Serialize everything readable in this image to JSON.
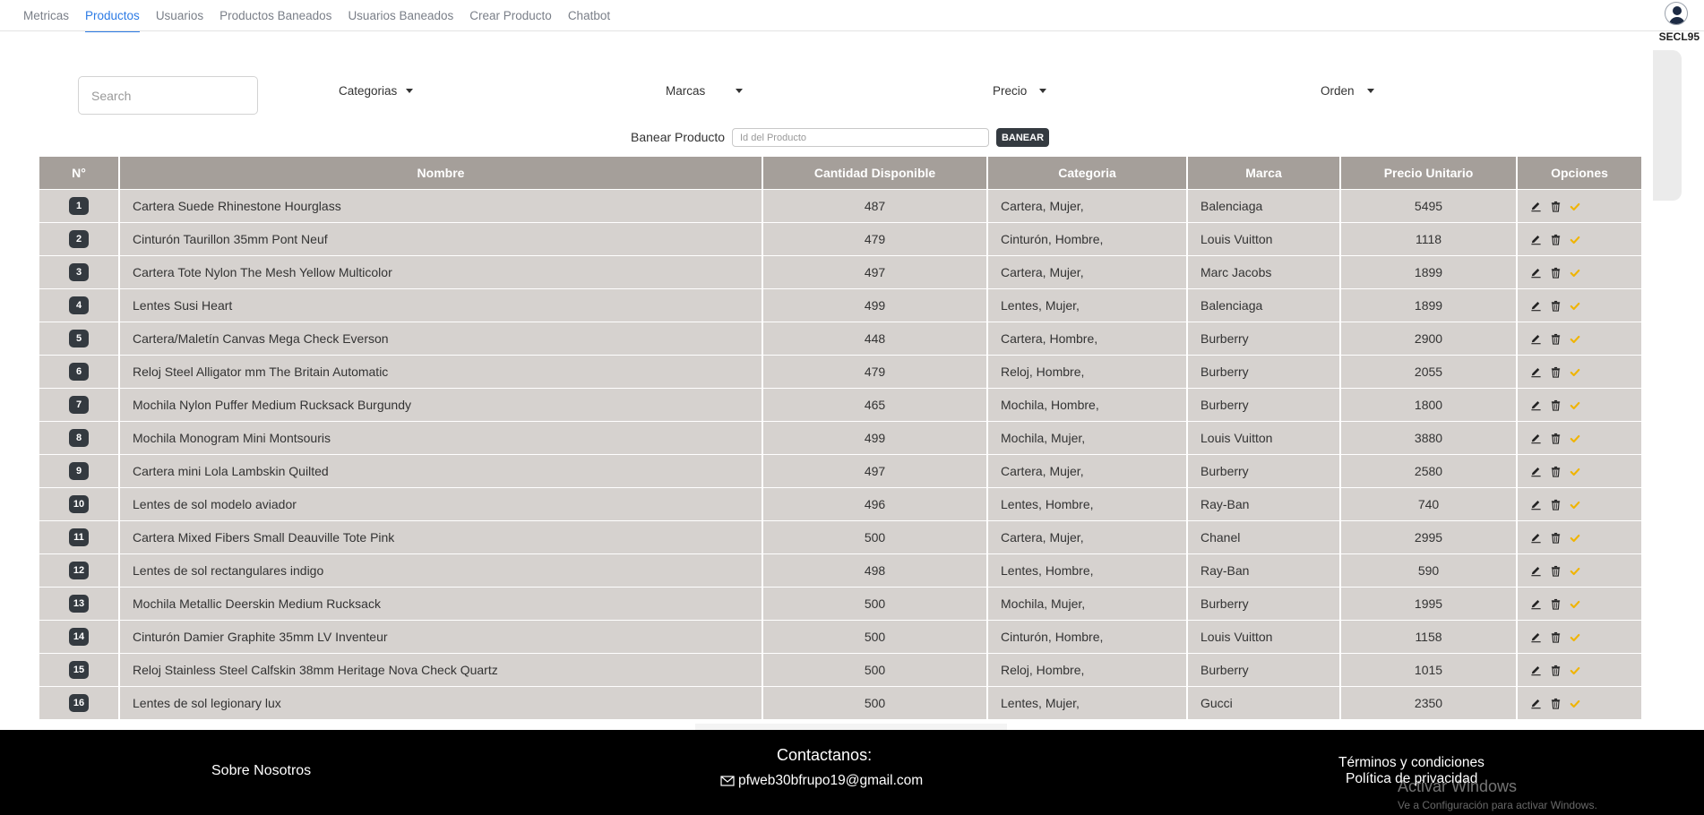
{
  "nav": {
    "tabs": [
      {
        "label": "Metricas"
      },
      {
        "label": "Productos"
      },
      {
        "label": "Usuarios"
      },
      {
        "label": "Productos Baneados"
      },
      {
        "label": "Usuarios Baneados"
      },
      {
        "label": "Crear Producto"
      },
      {
        "label": "Chatbot"
      }
    ],
    "active_tab": "Productos",
    "user_name": "SECL95"
  },
  "filters": {
    "search_placeholder": "Search",
    "categorias": "Categorias",
    "marcas": "Marcas",
    "precio": "Precio",
    "orden": "Orden"
  },
  "ban": {
    "label": "Banear Producto",
    "placeholder": "Id del Producto",
    "button": "BANEAR"
  },
  "table": {
    "headers": [
      "N°",
      "Nombre",
      "Cantidad Disponible",
      "Categoria",
      "Marca",
      "Precio Unitario",
      "Opciones"
    ],
    "rows": [
      {
        "n": "1",
        "nombre": "Cartera Suede Rhinestone Hourglass",
        "cantidad": "487",
        "categoria": "Cartera, Mujer,",
        "marca": "Balenciaga",
        "precio": "5495"
      },
      {
        "n": "2",
        "nombre": "Cinturón Taurillon 35mm Pont Neuf",
        "cantidad": "479",
        "categoria": "Cinturón, Hombre,",
        "marca": "Louis Vuitton",
        "precio": "1118"
      },
      {
        "n": "3",
        "nombre": "Cartera Tote Nylon The Mesh Yellow Multicolor",
        "cantidad": "497",
        "categoria": "Cartera, Mujer,",
        "marca": "Marc Jacobs",
        "precio": "1899"
      },
      {
        "n": "4",
        "nombre": "Lentes Susi Heart",
        "cantidad": "499",
        "categoria": "Lentes, Mujer,",
        "marca": "Balenciaga",
        "precio": "1899"
      },
      {
        "n": "5",
        "nombre": "Cartera/Maletín Canvas Mega Check Everson",
        "cantidad": "448",
        "categoria": "Cartera, Hombre,",
        "marca": "Burberry",
        "precio": "2900"
      },
      {
        "n": "6",
        "nombre": "Reloj Steel Alligator mm The Britain Automatic",
        "cantidad": "479",
        "categoria": "Reloj, Hombre,",
        "marca": "Burberry",
        "precio": "2055"
      },
      {
        "n": "7",
        "nombre": "Mochila Nylon Puffer Medium Rucksack Burgundy",
        "cantidad": "465",
        "categoria": "Mochila, Hombre,",
        "marca": "Burberry",
        "precio": "1800"
      },
      {
        "n": "8",
        "nombre": "Mochila Monogram Mini Montsouris",
        "cantidad": "499",
        "categoria": "Mochila, Mujer,",
        "marca": "Louis Vuitton",
        "precio": "3880"
      },
      {
        "n": "9",
        "nombre": "Cartera mini Lola Lambskin Quilted",
        "cantidad": "497",
        "categoria": "Cartera, Mujer,",
        "marca": "Burberry",
        "precio": "2580"
      },
      {
        "n": "10",
        "nombre": "Lentes de sol modelo aviador",
        "cantidad": "496",
        "categoria": "Lentes, Hombre,",
        "marca": "Ray-Ban",
        "precio": "740"
      },
      {
        "n": "11",
        "nombre": "Cartera Mixed Fibers Small Deauville Tote Pink",
        "cantidad": "500",
        "categoria": "Cartera, Mujer,",
        "marca": "Chanel",
        "precio": "2995"
      },
      {
        "n": "12",
        "nombre": "Lentes de sol rectangulares indigo",
        "cantidad": "498",
        "categoria": "Lentes, Hombre,",
        "marca": "Ray-Ban",
        "precio": "590"
      },
      {
        "n": "13",
        "nombre": "Mochila Metallic Deerskin Medium Rucksack",
        "cantidad": "500",
        "categoria": "Mochila, Mujer,",
        "marca": "Burberry",
        "precio": "1995"
      },
      {
        "n": "14",
        "nombre": "Cinturón Damier Graphite 35mm LV Inventeur",
        "cantidad": "500",
        "categoria": "Cinturón, Hombre,",
        "marca": "Louis Vuitton",
        "precio": "1158"
      },
      {
        "n": "15",
        "nombre": "Reloj Stainless Steel Calfskin 38mm Heritage Nova Check Quartz",
        "cantidad": "500",
        "categoria": "Reloj, Hombre,",
        "marca": "Burberry",
        "precio": "1015"
      },
      {
        "n": "16",
        "nombre": "Lentes de sol legionary lux",
        "cantidad": "500",
        "categoria": "Lentes, Mujer,",
        "marca": "Gucci",
        "precio": "2350"
      }
    ],
    "option_icons": [
      "edit-icon",
      "trash-icon",
      "check-icon"
    ]
  },
  "footer": {
    "about": "Sobre Nosotros",
    "contact_title": "Contactanos:",
    "email": "pfweb30bfrupo19@gmail.com",
    "terms": "Términos y condiciones",
    "privacy": "Política de privacidad",
    "activate_windows": "Activar Windows",
    "activate_windows_sub": "Ve a Configuración para activar Windows."
  },
  "colors": {
    "accent": "#2c7be5",
    "header_bg": "#a59f9a",
    "row_bg": "#d6d2cf",
    "badge_bg": "#343a40",
    "check": "#f0b400",
    "footer_bg": "#000000"
  }
}
